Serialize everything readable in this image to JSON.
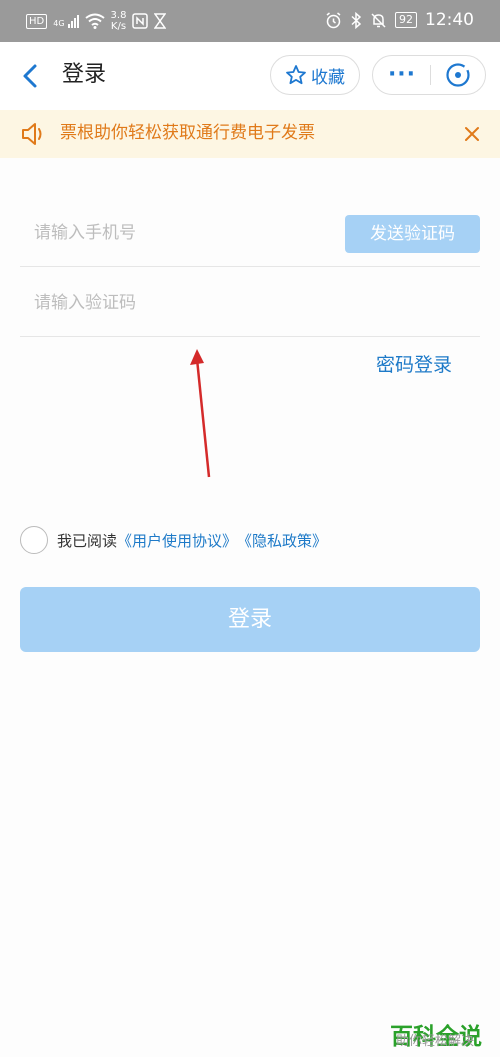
{
  "status_bar": {
    "network_badge": "HD",
    "signal_label": "4G",
    "speed_value": "3.8",
    "speed_unit": "K/s",
    "battery": "92",
    "time": "12:40"
  },
  "navbar": {
    "title": "登录",
    "favorite_label": "收藏",
    "more_label": "···"
  },
  "notice": {
    "text": "票根助你轻松获取通行费电子发票"
  },
  "form": {
    "phone_placeholder": "请输入手机号",
    "code_placeholder": "请输入验证码",
    "send_code_label": "发送验证码",
    "password_login_label": "密码登录"
  },
  "agreement": {
    "prefix": "我已阅读",
    "user_agreement": "《用户使用协议》",
    "privacy_policy": "《隐私政策》"
  },
  "login_button_label": "登录",
  "watermark": {
    "title": "百科全说",
    "subtitle": "助你轻松解决"
  },
  "colors": {
    "accent_blue": "#1e7ac8",
    "disabled_blue": "#a6d1f5",
    "notice_orange": "#e07a1a",
    "notice_bg": "#fdf6e3",
    "status_bar": "#9a9a9a"
  }
}
